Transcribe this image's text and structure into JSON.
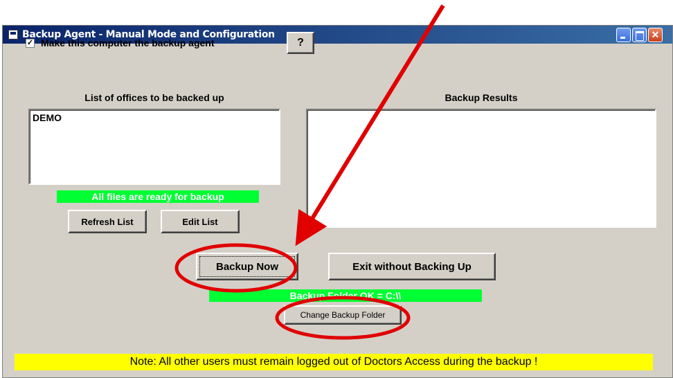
{
  "window": {
    "title": "Backup Agent - Manual Mode and Configuration"
  },
  "agent_checkbox": {
    "checked": true,
    "check_glyph": "✓",
    "label": "Make this computer the backup agent"
  },
  "help_button": {
    "label": "?"
  },
  "offices": {
    "heading": "List of offices to be backed up",
    "items": [
      "DEMO"
    ],
    "status": "All files are ready for backup",
    "refresh_label": "Refresh List",
    "edit_label": "Edit List"
  },
  "results": {
    "heading": "Backup Results"
  },
  "actions": {
    "backup_now": "Backup Now",
    "exit": "Exit without Backing Up",
    "folder_status": "Backup Folder OK = C:\\\\",
    "change_folder": "Change Backup Folder"
  },
  "note": "Note: All other users must remain logged out of Doctors Access during the backup !",
  "colors": {
    "status_bg": "#00ff33",
    "note_bg": "#ffff00",
    "annotation_red": "#e00000"
  }
}
